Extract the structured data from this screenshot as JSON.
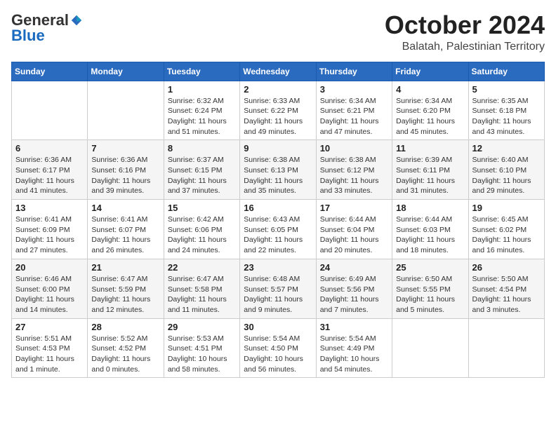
{
  "header": {
    "logo": {
      "general": "General",
      "blue": "Blue",
      "tagline": ""
    },
    "title": "October 2024",
    "location": "Balatah, Palestinian Territory"
  },
  "weekdays": [
    "Sunday",
    "Monday",
    "Tuesday",
    "Wednesday",
    "Thursday",
    "Friday",
    "Saturday"
  ],
  "weeks": [
    [
      null,
      null,
      {
        "day": 1,
        "sunrise": "Sunrise: 6:32 AM",
        "sunset": "Sunset: 6:24 PM",
        "daylight": "Daylight: 11 hours and 51 minutes."
      },
      {
        "day": 2,
        "sunrise": "Sunrise: 6:33 AM",
        "sunset": "Sunset: 6:22 PM",
        "daylight": "Daylight: 11 hours and 49 minutes."
      },
      {
        "day": 3,
        "sunrise": "Sunrise: 6:34 AM",
        "sunset": "Sunset: 6:21 PM",
        "daylight": "Daylight: 11 hours and 47 minutes."
      },
      {
        "day": 4,
        "sunrise": "Sunrise: 6:34 AM",
        "sunset": "Sunset: 6:20 PM",
        "daylight": "Daylight: 11 hours and 45 minutes."
      },
      {
        "day": 5,
        "sunrise": "Sunrise: 6:35 AM",
        "sunset": "Sunset: 6:18 PM",
        "daylight": "Daylight: 11 hours and 43 minutes."
      }
    ],
    [
      {
        "day": 6,
        "sunrise": "Sunrise: 6:36 AM",
        "sunset": "Sunset: 6:17 PM",
        "daylight": "Daylight: 11 hours and 41 minutes."
      },
      {
        "day": 7,
        "sunrise": "Sunrise: 6:36 AM",
        "sunset": "Sunset: 6:16 PM",
        "daylight": "Daylight: 11 hours and 39 minutes."
      },
      {
        "day": 8,
        "sunrise": "Sunrise: 6:37 AM",
        "sunset": "Sunset: 6:15 PM",
        "daylight": "Daylight: 11 hours and 37 minutes."
      },
      {
        "day": 9,
        "sunrise": "Sunrise: 6:38 AM",
        "sunset": "Sunset: 6:13 PM",
        "daylight": "Daylight: 11 hours and 35 minutes."
      },
      {
        "day": 10,
        "sunrise": "Sunrise: 6:38 AM",
        "sunset": "Sunset: 6:12 PM",
        "daylight": "Daylight: 11 hours and 33 minutes."
      },
      {
        "day": 11,
        "sunrise": "Sunrise: 6:39 AM",
        "sunset": "Sunset: 6:11 PM",
        "daylight": "Daylight: 11 hours and 31 minutes."
      },
      {
        "day": 12,
        "sunrise": "Sunrise: 6:40 AM",
        "sunset": "Sunset: 6:10 PM",
        "daylight": "Daylight: 11 hours and 29 minutes."
      }
    ],
    [
      {
        "day": 13,
        "sunrise": "Sunrise: 6:41 AM",
        "sunset": "Sunset: 6:09 PM",
        "daylight": "Daylight: 11 hours and 27 minutes."
      },
      {
        "day": 14,
        "sunrise": "Sunrise: 6:41 AM",
        "sunset": "Sunset: 6:07 PM",
        "daylight": "Daylight: 11 hours and 26 minutes."
      },
      {
        "day": 15,
        "sunrise": "Sunrise: 6:42 AM",
        "sunset": "Sunset: 6:06 PM",
        "daylight": "Daylight: 11 hours and 24 minutes."
      },
      {
        "day": 16,
        "sunrise": "Sunrise: 6:43 AM",
        "sunset": "Sunset: 6:05 PM",
        "daylight": "Daylight: 11 hours and 22 minutes."
      },
      {
        "day": 17,
        "sunrise": "Sunrise: 6:44 AM",
        "sunset": "Sunset: 6:04 PM",
        "daylight": "Daylight: 11 hours and 20 minutes."
      },
      {
        "day": 18,
        "sunrise": "Sunrise: 6:44 AM",
        "sunset": "Sunset: 6:03 PM",
        "daylight": "Daylight: 11 hours and 18 minutes."
      },
      {
        "day": 19,
        "sunrise": "Sunrise: 6:45 AM",
        "sunset": "Sunset: 6:02 PM",
        "daylight": "Daylight: 11 hours and 16 minutes."
      }
    ],
    [
      {
        "day": 20,
        "sunrise": "Sunrise: 6:46 AM",
        "sunset": "Sunset: 6:00 PM",
        "daylight": "Daylight: 11 hours and 14 minutes."
      },
      {
        "day": 21,
        "sunrise": "Sunrise: 6:47 AM",
        "sunset": "Sunset: 5:59 PM",
        "daylight": "Daylight: 11 hours and 12 minutes."
      },
      {
        "day": 22,
        "sunrise": "Sunrise: 6:47 AM",
        "sunset": "Sunset: 5:58 PM",
        "daylight": "Daylight: 11 hours and 11 minutes."
      },
      {
        "day": 23,
        "sunrise": "Sunrise: 6:48 AM",
        "sunset": "Sunset: 5:57 PM",
        "daylight": "Daylight: 11 hours and 9 minutes."
      },
      {
        "day": 24,
        "sunrise": "Sunrise: 6:49 AM",
        "sunset": "Sunset: 5:56 PM",
        "daylight": "Daylight: 11 hours and 7 minutes."
      },
      {
        "day": 25,
        "sunrise": "Sunrise: 6:50 AM",
        "sunset": "Sunset: 5:55 PM",
        "daylight": "Daylight: 11 hours and 5 minutes."
      },
      {
        "day": 26,
        "sunrise": "Sunrise: 5:50 AM",
        "sunset": "Sunset: 4:54 PM",
        "daylight": "Daylight: 11 hours and 3 minutes."
      }
    ],
    [
      {
        "day": 27,
        "sunrise": "Sunrise: 5:51 AM",
        "sunset": "Sunset: 4:53 PM",
        "daylight": "Daylight: 11 hours and 1 minute."
      },
      {
        "day": 28,
        "sunrise": "Sunrise: 5:52 AM",
        "sunset": "Sunset: 4:52 PM",
        "daylight": "Daylight: 11 hours and 0 minutes."
      },
      {
        "day": 29,
        "sunrise": "Sunrise: 5:53 AM",
        "sunset": "Sunset: 4:51 PM",
        "daylight": "Daylight: 10 hours and 58 minutes."
      },
      {
        "day": 30,
        "sunrise": "Sunrise: 5:54 AM",
        "sunset": "Sunset: 4:50 PM",
        "daylight": "Daylight: 10 hours and 56 minutes."
      },
      {
        "day": 31,
        "sunrise": "Sunrise: 5:54 AM",
        "sunset": "Sunset: 4:49 PM",
        "daylight": "Daylight: 10 hours and 54 minutes."
      },
      null,
      null
    ]
  ]
}
